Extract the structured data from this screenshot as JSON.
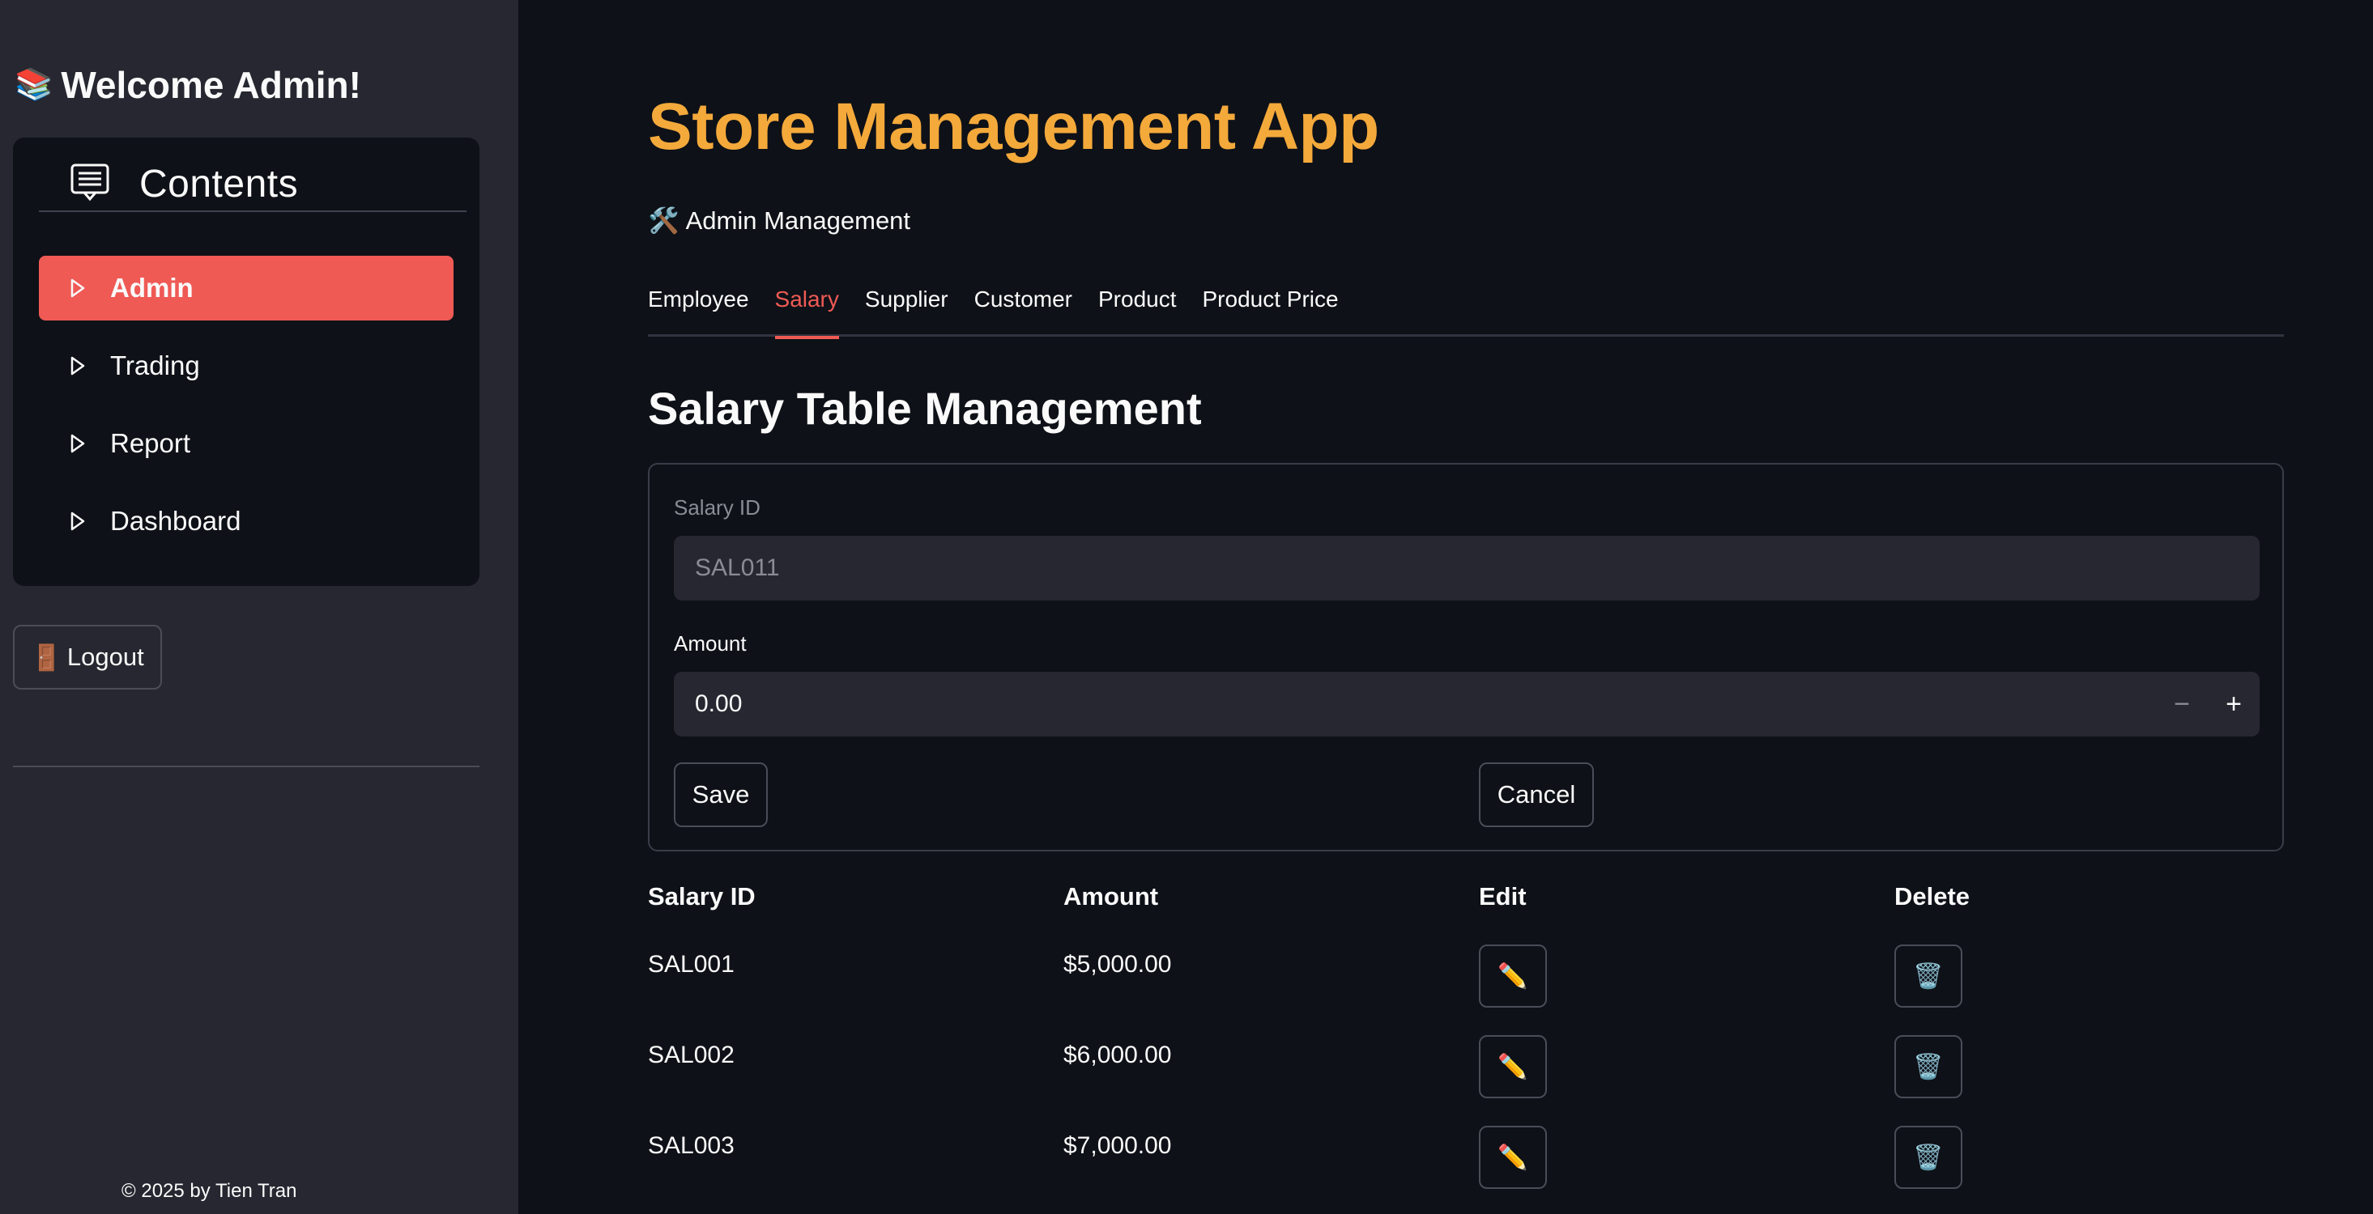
{
  "sidebar": {
    "welcome_icon": "📚",
    "welcome": "Welcome Admin!",
    "menu_title": "Contents",
    "menu_icon": "contents-list-icon",
    "items": [
      {
        "label": "Admin",
        "active": true
      },
      {
        "label": "Trading",
        "active": false
      },
      {
        "label": "Report",
        "active": false
      },
      {
        "label": "Dashboard",
        "active": false
      }
    ],
    "logout_icon": "🚪",
    "logout": "Logout",
    "footer": "© 2025 by Tien Tran"
  },
  "main": {
    "title": "Store Management App",
    "subheader_icon": "🛠️",
    "subheader": "Admin Management",
    "tabs": [
      {
        "label": "Employee",
        "active": false
      },
      {
        "label": "Salary",
        "active": true
      },
      {
        "label": "Supplier",
        "active": false
      },
      {
        "label": "Customer",
        "active": false
      },
      {
        "label": "Product",
        "active": false
      },
      {
        "label": "Product Price",
        "active": false
      }
    ],
    "section_title": "Salary Table Management",
    "form": {
      "salary_id_label": "Salary ID",
      "salary_id_value": "SAL011",
      "amount_label": "Amount",
      "amount_value": "0.00",
      "minus": "−",
      "plus": "+",
      "save": "Save",
      "cancel": "Cancel"
    },
    "table": {
      "headers": [
        "Salary ID",
        "Amount",
        "Edit",
        "Delete"
      ],
      "edit_icon": "✏️",
      "delete_icon": "🗑️",
      "rows": [
        {
          "id": "SAL001",
          "amount": "$5,000.00"
        },
        {
          "id": "SAL002",
          "amount": "$6,000.00"
        },
        {
          "id": "SAL003",
          "amount": "$7,000.00"
        }
      ]
    }
  },
  "colors": {
    "accent": "#ef5a55",
    "title": "#f4a93b",
    "sidebar_bg": "#262730",
    "main_bg": "#0e1117"
  }
}
